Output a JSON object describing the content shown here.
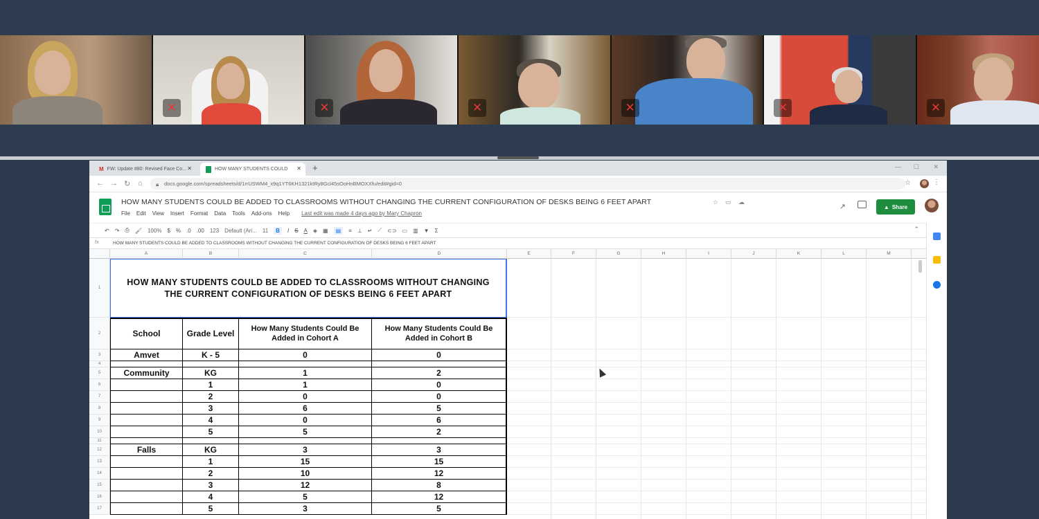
{
  "browser": {
    "tabs": [
      {
        "label": "FW: Update #80: Revised Face Co..."
      },
      {
        "label": "HOW MANY STUDENTS COULD"
      }
    ],
    "url": "docs.google.com/spreadsheets/d/1rrUSWM4_x9q1YT6KH1321ktRy8Gcl45sOoHnBMOXXfu/edit#gid=0"
  },
  "doc": {
    "title": "HOW MANY STUDENTS COULD BE ADDED TO CLASSROOMS WITHOUT CHANGING THE CURRENT CONFIGURATION OF DESKS BEING 6 FEET APART",
    "menus": [
      "File",
      "Edit",
      "View",
      "Insert",
      "Format",
      "Data",
      "Tools",
      "Add-ons",
      "Help"
    ],
    "last_edit": "Last edit was made 4 days ago by Mary Chapron",
    "share_label": "Share"
  },
  "toolbar": {
    "zoom": "100%",
    "currency": "$",
    "percent": "%",
    "dec1": ".0",
    "dec2": ".00",
    "format": "123",
    "font": "Default (Ari...",
    "size": "11",
    "bold": "B",
    "italic": "I",
    "strike": "S",
    "underline_a": "A",
    "sum": "Σ"
  },
  "formula_bar": {
    "fx": "fx",
    "content": "HOW MANY STUDENTS COULD BE ADDED TO CLASSROOMS WITHOUT CHANGING THE CURRENT CONFIGURATION OF DESKS BEING 6 FEET APART"
  },
  "columns": [
    "A",
    "B",
    "C",
    "D",
    "E",
    "F",
    "G",
    "H",
    "I",
    "J",
    "K",
    "L",
    "M"
  ],
  "rows": [
    "1",
    "2",
    "3",
    "4",
    "5",
    "6",
    "7",
    "8",
    "9",
    "10",
    "11",
    "12",
    "13",
    "14",
    "15",
    "16",
    "17"
  ],
  "sheet": {
    "title_line1": "HOW MANY STUDENTS COULD BE ADDED TO CLASSROOMS WITHOUT CHANGING",
    "title_line2": "THE CURRENT CONFIGURATION OF DESKS BEING 6 FEET APART",
    "headers": {
      "school": "School",
      "grade": "Grade Level",
      "cohort_a": "How Many Students Could Be Added in Cohort A",
      "cohort_b": "How Many Students Could Be Added in Cohort B"
    },
    "data": [
      {
        "school": "Amvet",
        "grade": "K - 5",
        "a": "0",
        "b": "0"
      },
      {
        "school": "",
        "grade": "",
        "a": "",
        "b": ""
      },
      {
        "school": "Community",
        "grade": "KG",
        "a": "1",
        "b": "2"
      },
      {
        "school": "",
        "grade": "1",
        "a": "1",
        "b": "0"
      },
      {
        "school": "",
        "grade": "2",
        "a": "0",
        "b": "0"
      },
      {
        "school": "",
        "grade": "3",
        "a": "6",
        "b": "5"
      },
      {
        "school": "",
        "grade": "4",
        "a": "0",
        "b": "6"
      },
      {
        "school": "",
        "grade": "5",
        "a": "5",
        "b": "2"
      },
      {
        "school": "",
        "grade": "",
        "a": "",
        "b": ""
      },
      {
        "school": "Falls",
        "grade": "KG",
        "a": "3",
        "b": "3"
      },
      {
        "school": "",
        "grade": "1",
        "a": "15",
        "b": "15"
      },
      {
        "school": "",
        "grade": "2",
        "a": "10",
        "b": "12"
      },
      {
        "school": "",
        "grade": "3",
        "a": "12",
        "b": "8"
      },
      {
        "school": "",
        "grade": "4",
        "a": "5",
        "b": "12"
      },
      {
        "school": "",
        "grade": "5",
        "a": "3",
        "b": "5"
      }
    ]
  },
  "colors": {
    "share_green": "#1e8e3e",
    "sheets_green": "#0f9d58",
    "muted_mic_red": "#e53935",
    "selection_blue": "#3b78e7"
  }
}
